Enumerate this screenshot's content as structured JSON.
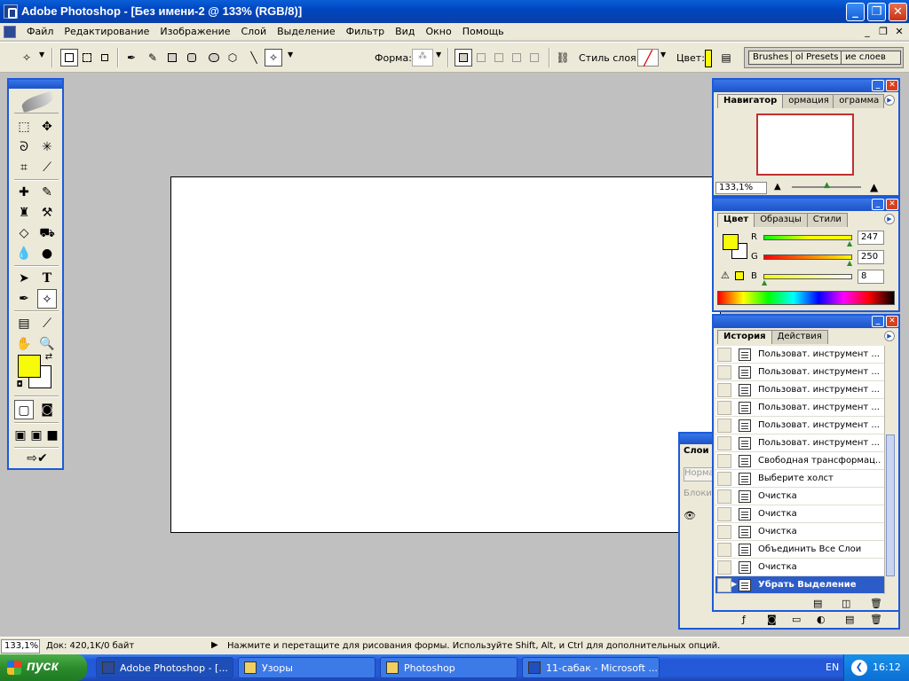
{
  "window": {
    "title": "Adobe Photoshop - [Без имени-2 @ 133% (RGB/8)]"
  },
  "menu": [
    "Файл",
    "Редактирование",
    "Изображение",
    "Слой",
    "Выделение",
    "Фильтр",
    "Вид",
    "Окно",
    "Помощь"
  ],
  "options": {
    "shape_label": "Форма:",
    "layer_style_label": "Стиль слоя:",
    "color_label": "Цвет:",
    "color_value": "#f7fa08",
    "well_tabs": [
      "Brushes",
      "ol Presets",
      "ие слоев"
    ]
  },
  "toolbox": {
    "foreground": "#f7fa08",
    "background": "#ffffff"
  },
  "navigator": {
    "tabs": [
      "Навигатор",
      "ормация",
      "ограмма"
    ],
    "zoom": "133,1%"
  },
  "color_panel": {
    "tabs": [
      "Цвет",
      "Образцы",
      "Стили"
    ],
    "channels": [
      {
        "name": "R",
        "value": "247"
      },
      {
        "name": "G",
        "value": "250"
      },
      {
        "name": "B",
        "value": "8"
      }
    ]
  },
  "history": {
    "tabs": [
      "История",
      "Действия"
    ],
    "items": [
      "Пользоват. инструмент ...",
      "Пользоват. инструмент ...",
      "Пользоват. инструмент ...",
      "Пользоват. инструмент ...",
      "Пользоват. инструмент ...",
      "Пользоват. инструмент ...",
      "Свободная трансформац...",
      "Выберите холст",
      "Очистка",
      "Очистка",
      "Очистка",
      "Объединить Все Слои",
      "Очистка",
      "Убрать Выделение"
    ],
    "active_index": 13
  },
  "layers": {
    "tab": "Слои",
    "blend": "Норма",
    "lock": "Блоки"
  },
  "status": {
    "zoom": "133,1%",
    "doc": "Док: 420,1K/0 байт",
    "hint": "Нажмите и перетащите для рисования формы. Используйте Shift, Alt, и Ctrl для дополнительных опций."
  },
  "taskbar": {
    "start": "пуск",
    "tasks": [
      "Adobe Photoshop - [...",
      "Узоры",
      "Photoshop",
      "11-сабак - Microsoft ..."
    ],
    "lang": "EN",
    "clock": "16:12"
  }
}
